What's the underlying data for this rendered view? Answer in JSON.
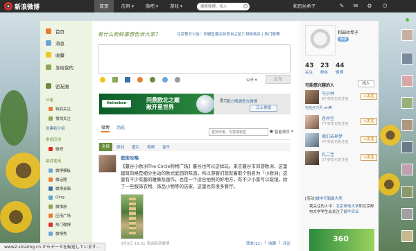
{
  "topnav": {
    "logo_text": "新浪微博",
    "tabs": [
      "首页",
      "应用",
      "微吧",
      "游戏"
    ],
    "search_placeholder": "搜索微博、找人",
    "user_name": "和田丝希子"
  },
  "leftnav": {
    "items": [
      "首页",
      "消息",
      "收藏",
      "发给我的"
    ],
    "square": "密友圈",
    "group_header": "分组",
    "groups": [
      "特别关注",
      "悄悄关注",
      "创建新分组"
    ],
    "apps_header": "常用应用",
    "app1": "微吧",
    "recent_header": "最近使用",
    "recent": [
      "微博模板",
      "微话题",
      "微博桌面",
      "Qing",
      "微相册",
      "应用广场",
      "热门微博",
      "微博秀"
    ]
  },
  "composer": {
    "title": "有什么新鲜事想告诉大家？",
    "notice": "北京警方公告：安徽坠楼女孩系自主坠亡排除他杀",
    "notice_link": "热门微博",
    "public_label": "公开",
    "post_button": "发布"
  },
  "ad": {
    "brand": "Heineken",
    "slogan1": "问鼎欧北之巅",
    "slogan2": "敞开星世界",
    "fan_prefix": "喜力",
    "fan_name": "喜力啤酒官方微博",
    "join_button": "马上参加"
  },
  "feed": {
    "tabs": [
      "微博",
      "动态"
    ],
    "search_placeholder": "查找作者、内容或标签",
    "sort_label": "智能排序",
    "categories": [
      "全部",
      "原创",
      "图片",
      "视频",
      "音乐"
    ],
    "post": {
      "author": "逛街攻略",
      "text": "【蔓谷小欧洲The Circle购物广场】蔓谷也可以这样玩。来去蔓谷市郊游欧洲，这里建筑风格是细分生动的欧式庭园的味道，所以游客们就就着取个别名为「小欧洲」这里有不少有趣的雕像及画作，也是一个适合拍照的好地方，有不少小景可以取镜。除了一些服饰衣物、饰品小物等的店家，这里也有很多餐厅。",
      "time": "3月9日 19:31",
      "source": "来自新浪微博",
      "actions": [
        "转发(11)",
        "收藏",
        "评论"
      ]
    }
  },
  "profile": {
    "name": "和田丝希子",
    "tag": "微博",
    "stats": [
      {
        "n": "43",
        "label": "关注"
      },
      {
        "n": "23",
        "label": "粉丝"
      },
      {
        "n": "44",
        "label": "微博"
      }
    ]
  },
  "interest": {
    "header": "可能感兴趣的人",
    "find_button": "找人",
    "follow_label": "+关注",
    "people": [
      {
        "name": "马小林",
        "mutual": "8个好友也关注他",
        "sub": "包括丝力尹_dn等"
      },
      {
        "name": "苍井空",
        "mutual": "7个好友也关注他",
        "sub": ""
      },
      {
        "name": "嗯们去养梦",
        "mutual": "4个好友也关注他",
        "sub": ""
      },
      {
        "name": "孔二宝",
        "mutual": "3个好友也关注他",
        "sub": ""
      }
    ]
  },
  "event": {
    "header": "[活动]",
    "header_link": "城中开箱赢大奖",
    "text": "我关注的人中：",
    "text_link": "北京邮电大学",
    "text2": "和北京邮电大学学生会关注了",
    "text_link2": "最牛实业"
  },
  "statusbar": {
    "text": "www2.sinaimg.cn からデータを転送しています..."
  }
}
